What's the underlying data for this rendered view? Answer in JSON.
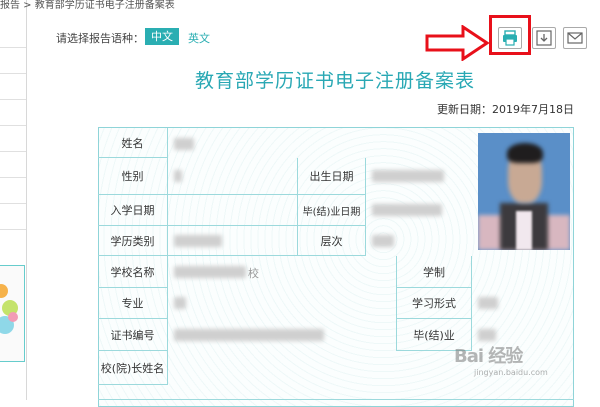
{
  "breadcrumb": "报告 > 教育部学历证书电子注册备案表",
  "language": {
    "label": "请选择报告语种：",
    "options": [
      "中文",
      "英文"
    ],
    "selected": "中文"
  },
  "toolbar": {
    "icons": [
      "print-icon",
      "download-icon",
      "mail-icon"
    ],
    "highlight_color": "#e8101a"
  },
  "document": {
    "title": "教育部学历证书电子注册备案表",
    "update_date": "更新日期：2019年7月18日"
  },
  "fields": {
    "name": "姓名",
    "gender": "性别",
    "birth_date": "出生日期",
    "enroll_date": "入学日期",
    "grad_date": "毕(结)业日期",
    "edu_type": "学历类别",
    "level": "层次",
    "school": "学校名称",
    "school_suffix": "校",
    "duration": "学制",
    "major": "专业",
    "study_form": "学习形式",
    "cert_no": "证书编号",
    "grad_status": "毕(结)业",
    "president": "校(院)长姓名"
  },
  "watermark": {
    "brand": "Bai 经验",
    "sub": "jingyan.baidu.com"
  },
  "colors": {
    "accent": "#2aaeb2",
    "title": "#29a8b4",
    "border": "#9cd9dc"
  }
}
